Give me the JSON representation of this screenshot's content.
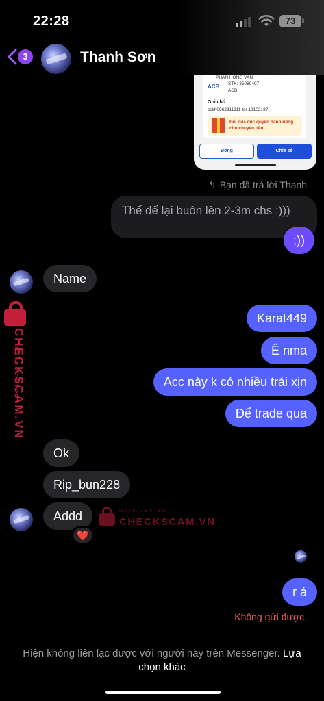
{
  "status_bar": {
    "time": "22:28",
    "battery": "73"
  },
  "header": {
    "back_badge": "3",
    "contact_name": "Thanh Sơn"
  },
  "shared_image": {
    "name_line": "PHAN HONG VAN",
    "bank": "ACB",
    "account": "STK: 35089497",
    "bank_small": "ACB",
    "note_label": "Ghi chú",
    "note_value": "cskh0962311311 tsr 12102187",
    "promo": "Đổi quà độc quyền dành riêng cho chuyển tiền",
    "close_label": "Đóng",
    "share_label": "Chia sẻ"
  },
  "reply": {
    "label": "Bạn đã trả lời Thanh",
    "quoted_text": "Thế để lại buôn lên 2-3m chs :)))"
  },
  "messages": {
    "m1": ";))",
    "m2": "Name",
    "m3": "Karat449",
    "m4": "Ê nma",
    "m5": "Acc này k có nhiều trái xịn",
    "m6": "Để trade qua",
    "m7": "Ok",
    "m8": "Rip_bun228",
    "m9": "Addd",
    "m10": "r á"
  },
  "reaction": "❤️",
  "send_failed": "Không gửi được.",
  "footer": {
    "text": "Hiện không liên lạc được với người này trên Messenger.",
    "choice": "Lựa chọn khác"
  },
  "watermark": {
    "main": "CHECKSCAM.VN",
    "sub": "DATA CENTER"
  },
  "colors": {
    "outgoing": "#5562ff",
    "incoming": "#262628",
    "error": "#f05a5a",
    "accent": "#8a44f2"
  }
}
